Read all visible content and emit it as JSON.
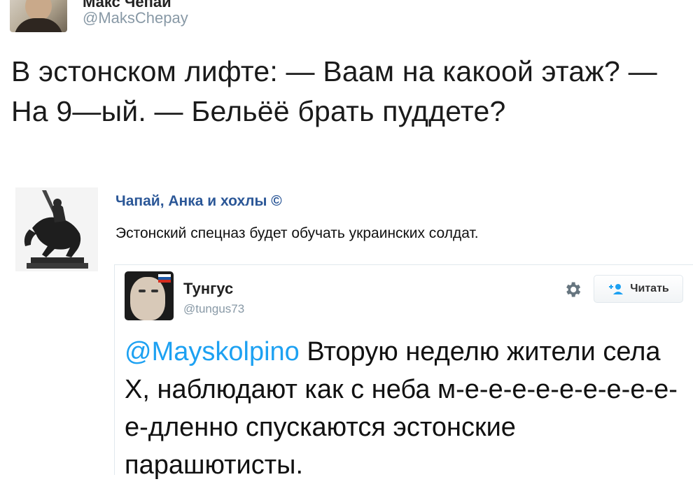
{
  "tweet": {
    "author_name": "Макс Чепай",
    "handle": "@MaksChepay",
    "text": "В эстонском лифте: — Ваам на какоой этаж? — На 9—ый. — Бельёё брать пуддете?"
  },
  "quoted": {
    "title": "Чапай, Анка и хохлы ©",
    "text": "Эстонский спецназ будет обучать украинских солдат."
  },
  "embedded_tweet": {
    "name": "Тунгус",
    "handle": "@tungus73",
    "follow_label": "Читать",
    "mention": "@Mayskolpino",
    "text": " Вторую неделю жители села Х, наблюдают как с неба м-е-е-е-е-е-е-е-е-е-е-дленно спускаются эстонские парашютисты."
  },
  "colors": {
    "link": "#1da1f2",
    "quote_title": "#2b5797",
    "handle": "#8899a6"
  },
  "icons": [
    "avatar",
    "statue-icon",
    "gear-icon",
    "follow-person-icon"
  ]
}
